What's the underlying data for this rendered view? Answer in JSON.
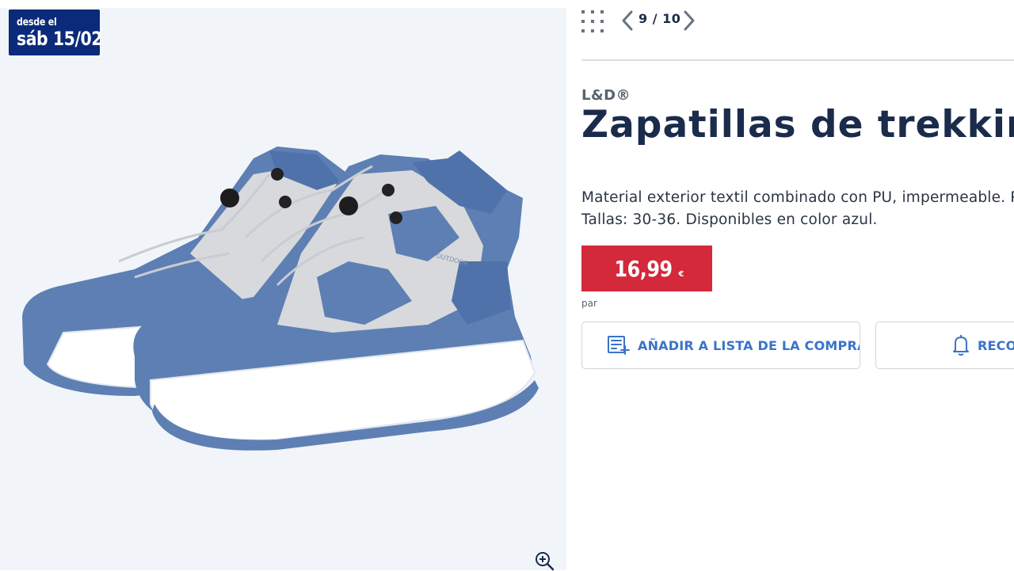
{
  "badge": {
    "line1": "desde el",
    "line2": "sáb 15/02"
  },
  "gallery": {
    "pager": "9 / 10",
    "image_label": "OUTDOOR"
  },
  "product": {
    "brand": "L&D®",
    "title": "Zapatillas de trekking",
    "description_line1": "Material exterior textil combinado con PU, impermeable. Planti",
    "description_line2": "Tallas: 30-36. Disponibles en color azul.",
    "price": "16,99",
    "currency": "€",
    "unit": "par"
  },
  "actions": {
    "add_to_list": "AÑADIR A LISTA DE LA COMPRA",
    "reminder": "RECO"
  },
  "colors": {
    "accent": "#3a74c7",
    "price_bg": "#d3293a",
    "badge_bg": "#0b2a7a",
    "title": "#1a2b4c"
  },
  "icons": [
    "grid-icon",
    "chevron-left-icon",
    "chevron-right-icon",
    "zoom-in-icon",
    "shopping-list-icon",
    "bell-icon"
  ]
}
